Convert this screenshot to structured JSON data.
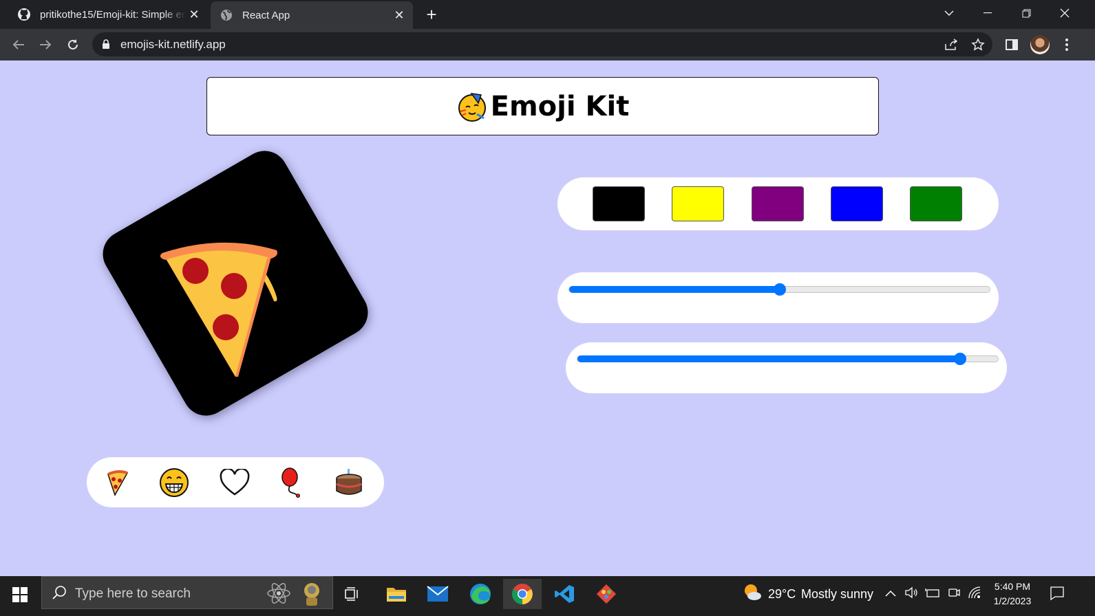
{
  "browser": {
    "tabs": [
      {
        "title": "pritikothe15/Emoji-kit: Simple em",
        "icon": "github-icon"
      },
      {
        "title": "React App",
        "icon": "globe-icon"
      }
    ],
    "url": "emojis-kit.netlify.app"
  },
  "page": {
    "title": "Emoji Kit",
    "title_emoji": "partying-face",
    "selected_emoji": "pizza",
    "card_color": "#000000",
    "emoji_options": [
      "pizza",
      "grinning-face",
      "white-heart",
      "balloon",
      "cake"
    ],
    "colors": [
      "#000000",
      "#ffff00",
      "#800080",
      "#0000ff",
      "#008000"
    ],
    "sliders": [
      {
        "name": "size",
        "value": 50,
        "min": 0,
        "max": 100
      },
      {
        "name": "rotation",
        "value": 91,
        "min": 0,
        "max": 100
      }
    ]
  },
  "taskbar": {
    "search_placeholder": "Type here to search",
    "weather": {
      "temp": "29°C",
      "desc": "Mostly sunny"
    },
    "time": "5:40 PM",
    "date": "1/2/2023"
  }
}
